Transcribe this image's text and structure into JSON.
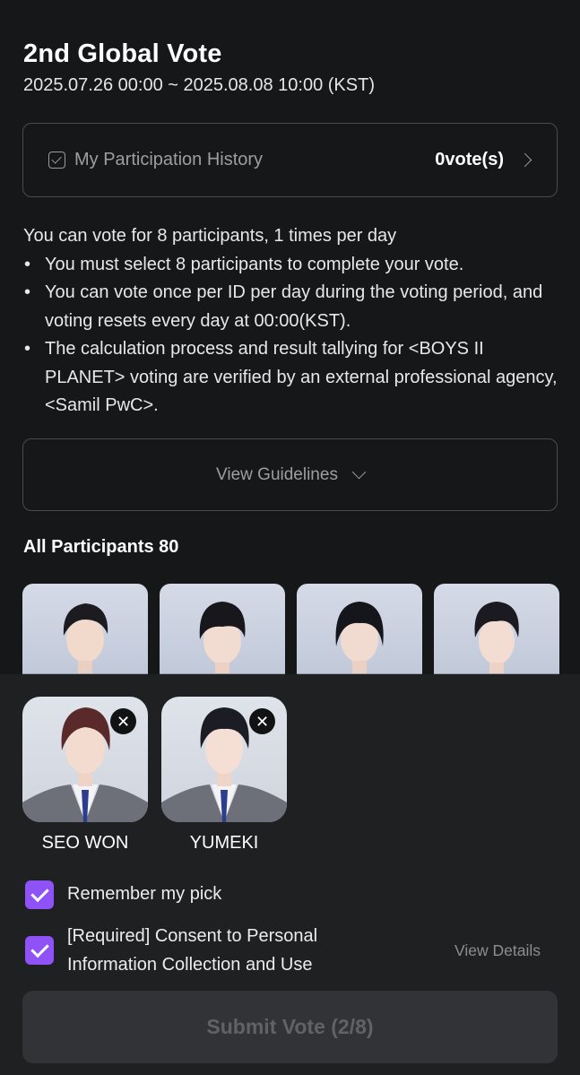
{
  "header": {
    "title": "2nd Global Vote",
    "period": "2025.07.26 00:00 ~ 2025.08.08 10:00 (KST)"
  },
  "history": {
    "label": "My Participation History",
    "count": "0vote(s)"
  },
  "rules": {
    "intro": "You can vote for 8 participants, 1 times per day",
    "bullets": [
      "You must select 8 participants to complete your vote.",
      "You can vote once per ID per day during the voting period, and voting resets every day at 00:00(KST).",
      "The calculation process and result tallying for <BOYS II PLANET> voting are verified by an external professional agency, <Samil PwC>."
    ]
  },
  "guidelines": {
    "label": "View Guidelines"
  },
  "participants": {
    "title": "All Participants 80"
  },
  "picks": [
    {
      "name": "SEO WON",
      "hair": "#5a2a2a"
    },
    {
      "name": "YUMEKI",
      "hair": "#1c1d24"
    }
  ],
  "options": {
    "remember": "Remember my pick",
    "consent": "[Required] Consent to Personal Information Collection and Use",
    "view_details": "View Details"
  },
  "submit": {
    "label": "Submit Vote (2/8)"
  },
  "colors": {
    "background": "#161719",
    "sheet": "#1f2022",
    "accent": "#8e52f6",
    "button_disabled": "#323336"
  }
}
